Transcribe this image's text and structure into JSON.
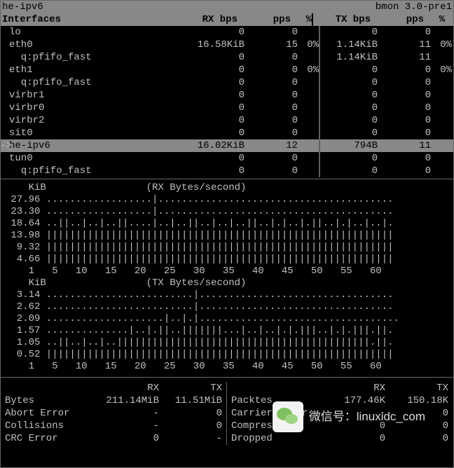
{
  "title": "he-ipv6",
  "version": "bmon 3.0-pre1",
  "headers": {
    "name": "Interfaces",
    "rxbps": "RX bps",
    "rxpps": "pps",
    "rxpct": "%",
    "txbps": "TX bps",
    "txpps": "pps",
    "txpct": "%"
  },
  "interfaces": [
    {
      "indent": 0,
      "name": "lo",
      "rxbps": "0",
      "rxpps": "0",
      "rxpct": "",
      "txbps": "0",
      "txpps": "0",
      "txpct": "",
      "selected": false
    },
    {
      "indent": 0,
      "name": "eth0",
      "rxbps": "16.58KiB",
      "rxpps": "15",
      "rxpct": "0%",
      "txbps": "1.14KiB",
      "txpps": "11",
      "txpct": "0%",
      "selected": false
    },
    {
      "indent": 1,
      "name": "q:pfifo_fast",
      "rxbps": "0",
      "rxpps": "0",
      "rxpct": "",
      "txbps": "1.14KiB",
      "txpps": "11",
      "txpct": "",
      "selected": false
    },
    {
      "indent": 0,
      "name": "eth1",
      "rxbps": "0",
      "rxpps": "0",
      "rxpct": "0%",
      "txbps": "0",
      "txpps": "0",
      "txpct": "0%",
      "selected": false
    },
    {
      "indent": 1,
      "name": "q:pfifo_fast",
      "rxbps": "0",
      "rxpps": "0",
      "rxpct": "",
      "txbps": "0",
      "txpps": "0",
      "txpct": "",
      "selected": false
    },
    {
      "indent": 0,
      "name": "virbr1",
      "rxbps": "0",
      "rxpps": "0",
      "rxpct": "",
      "txbps": "0",
      "txpps": "0",
      "txpct": "",
      "selected": false
    },
    {
      "indent": 0,
      "name": "virbr0",
      "rxbps": "0",
      "rxpps": "0",
      "rxpct": "",
      "txbps": "0",
      "txpps": "0",
      "txpct": "",
      "selected": false
    },
    {
      "indent": 0,
      "name": "virbr2",
      "rxbps": "0",
      "rxpps": "0",
      "rxpct": "",
      "txbps": "0",
      "txpps": "0",
      "txpct": "",
      "selected": false
    },
    {
      "indent": 0,
      "name": "sit0",
      "rxbps": "0",
      "rxpps": "0",
      "rxpct": "",
      "txbps": "0",
      "txpps": "0",
      "txpct": "",
      "selected": false
    },
    {
      "indent": 0,
      "name": "he-ipv6",
      "rxbps": "16.02KiB",
      "rxpps": "12",
      "rxpct": "",
      "txbps": "794B",
      "txpps": "11",
      "txpct": "",
      "selected": true
    },
    {
      "indent": 0,
      "name": "tun0",
      "rxbps": "0",
      "rxpps": "0",
      "rxpct": "",
      "txbps": "0",
      "txpps": "0",
      "txpct": "",
      "selected": false
    },
    {
      "indent": 1,
      "name": "q:pfifo_fast",
      "rxbps": "0",
      "rxpps": "0",
      "rxpct": "",
      "txbps": "0",
      "txpps": "0",
      "txpct": "",
      "selected": false
    }
  ],
  "graphs": {
    "rx": {
      "unit": "KiB",
      "title": "(RX Bytes/second)",
      "rows": [
        {
          "label": "27.96",
          "line": "..................|........................................"
        },
        {
          "label": "23.30",
          "line": "..................|........................................"
        },
        {
          "label": "18.64",
          "line": "..||..|..|..||....|..|..||..|..|..||..|.|..|.||..|.|..|..|."
        },
        {
          "label": "13.98",
          "line": "|||||||||||||||||||||||||||||||||||||||||||||||||||||||||||"
        },
        {
          "label": " 9.32",
          "line": "|||||||||||||||||||||||||||||||||||||||||||||||||||||||||||"
        },
        {
          "label": " 4.66",
          "line": "|||||||||||||||||||||||||||||||||||||||||||||||||||||||||||"
        }
      ],
      "axis": "   1   5   10   15   20   25   30   35   40   45   50   55   60"
    },
    "tx": {
      "unit": "KiB",
      "title": "(TX Bytes/second)",
      "rows": [
        {
          "label": " 3.14",
          "line": ".........................|................................."
        },
        {
          "label": " 2.62",
          "line": ".........................|................................."
        },
        {
          "label": " 2.09",
          "line": "....................|..|.|.................................."
        },
        {
          "label": " 1.57",
          "line": "..............|..|.||..|||||||...|..|..|.|.|||..|.|.|||.||."
        },
        {
          "label": " 1.05",
          "line": "..||..|..|..|||||||||||||||||||||||||||||||||||||||||||.||."
        },
        {
          "label": " 0.52",
          "line": "|||||||||||||||||||||||||||||||||||||||||||||||||||||||||||"
        }
      ],
      "axis": "   1   5   10   15   20   25   30   35   40   45   50   55   60"
    }
  },
  "stats": {
    "left": {
      "cols": {
        "rx": "RX",
        "tx": "TX"
      },
      "rows": [
        {
          "label": "Bytes",
          "rx": "211.14MiB",
          "tx": "11.51MiB"
        },
        {
          "label": "Abort Error",
          "rx": "-",
          "tx": "0"
        },
        {
          "label": "Collisions",
          "rx": "-",
          "tx": "0"
        },
        {
          "label": "CRC Error",
          "rx": "0",
          "tx": "-"
        }
      ]
    },
    "right": {
      "cols": {
        "rx": "RX",
        "tx": "TX"
      },
      "rows": [
        {
          "label": "Packtes",
          "rx": "177.46K",
          "tx": "150.18K"
        },
        {
          "label": "Carrier Error",
          "rx": "-",
          "tx": "0"
        },
        {
          "label": "Compressed",
          "rx": "0",
          "tx": "0"
        },
        {
          "label": "Dropped",
          "rx": "0",
          "tx": "0"
        }
      ]
    }
  },
  "watermark": "微信号：linuxidc_com"
}
